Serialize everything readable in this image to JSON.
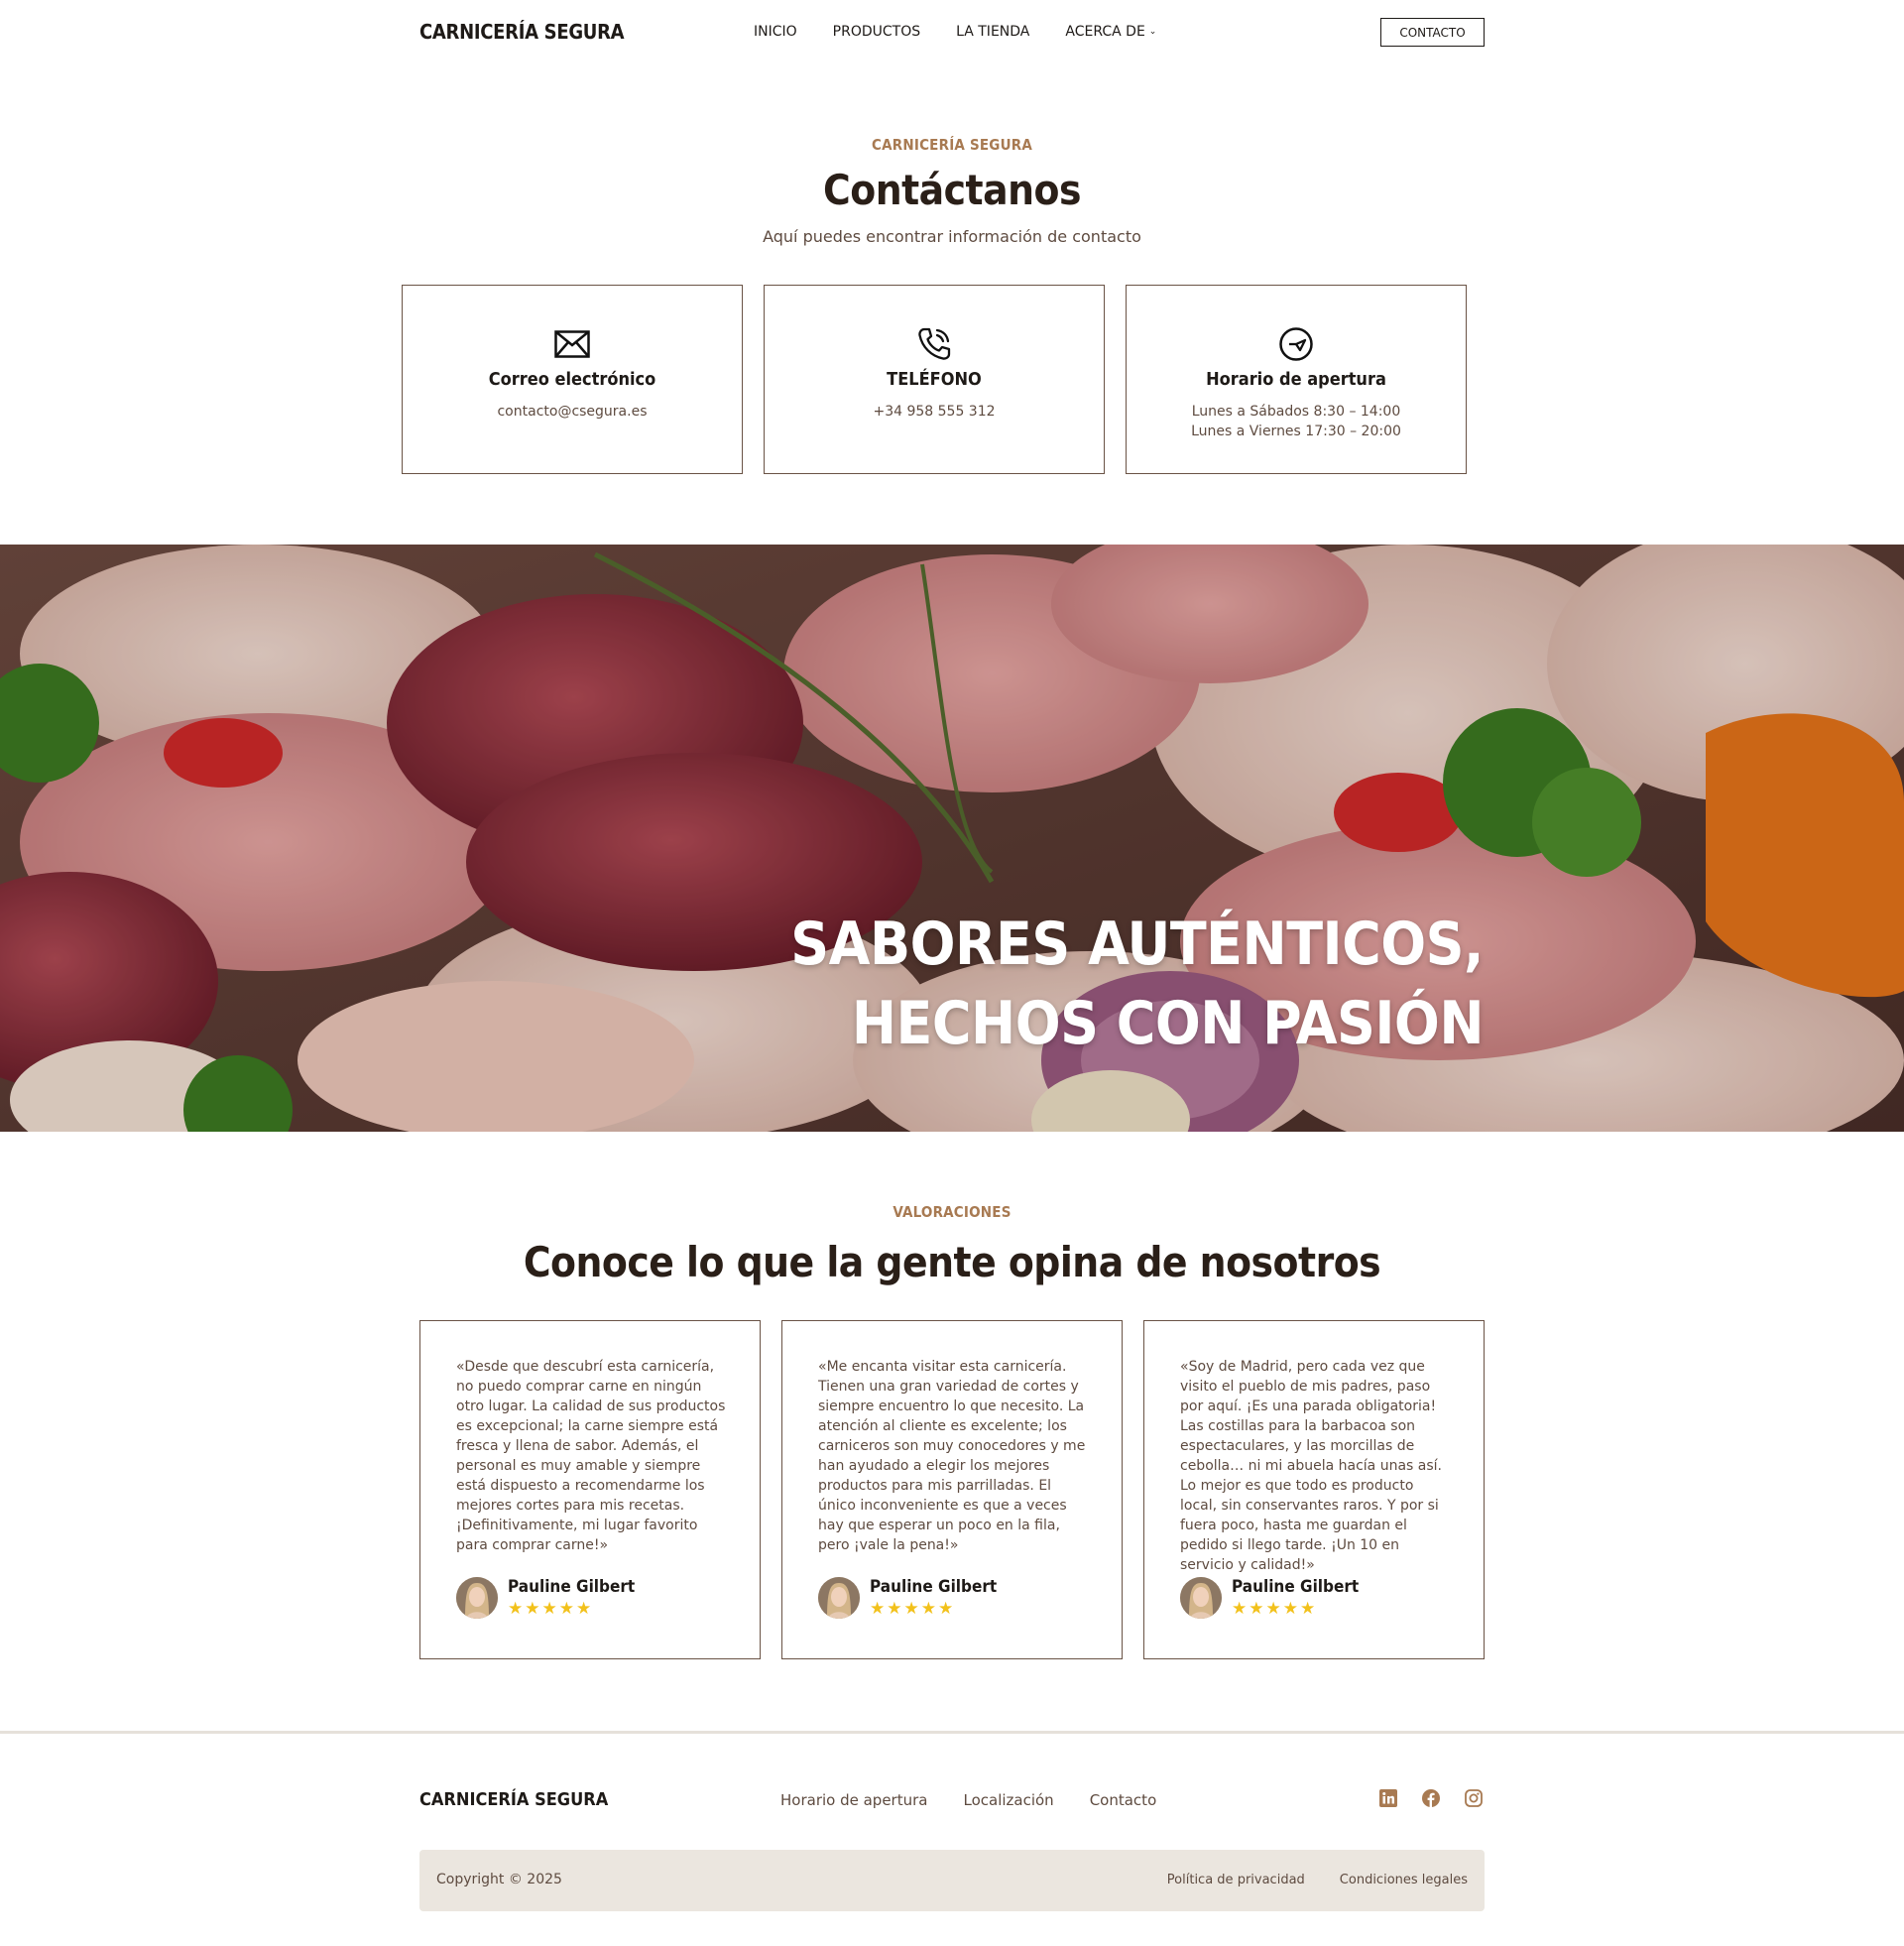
{
  "header": {
    "logo": "CARNICERÍA SEGURA",
    "nav": [
      "INICIO",
      "PRODUCTOS",
      "LA TIENDA",
      "ACERCA DE"
    ],
    "contact_button": "CONTACTO"
  },
  "contact": {
    "eyebrow": "CARNICERÍA SEGURA",
    "title": "Contáctanos",
    "subtitle": "Aquí puedes encontrar información de contacto",
    "cards": [
      {
        "icon": "envelope-icon",
        "title": "Correo electrónico",
        "lines": [
          "contacto@csegura.es"
        ]
      },
      {
        "icon": "phone-icon",
        "title": "TELÉFONO",
        "lines": [
          "+34 958 555 312"
        ]
      },
      {
        "icon": "clock-icon",
        "title": "Horario de apertura",
        "lines": [
          "Lunes a Sábados 8:30 – 14:00",
          "Lunes a Viernes 17:30 – 20:00"
        ]
      }
    ]
  },
  "hero": {
    "line1": "SABORES AUTÉNTICOS,",
    "line2": "HECHOS CON PASIÓN"
  },
  "reviews": {
    "eyebrow": "VALORACIONES",
    "title": "Conoce lo que la gente opina de nosotros",
    "items": [
      {
        "text": "«Desde que descubrí esta carnicería, no puedo comprar carne en ningún otro lugar. La calidad de sus productos es excepcional; la carne siempre está fresca y llena de sabor. Además, el personal es muy amable y siempre está dispuesto a recomendarme los mejores cortes para mis recetas. ¡Definitivamente, mi lugar favorito para comprar carne!»",
        "author": "Pauline Gilbert",
        "rating": 5
      },
      {
        "text": "«Me encanta visitar esta carnicería. Tienen una gran variedad de cortes y siempre encuentro lo que necesito. La atención al cliente es excelente; los carniceros son muy conocedores y me han ayudado a elegir los mejores productos para mis parrilladas. El único inconveniente es que a veces hay que esperar un poco en la fila, pero ¡vale la pena!»",
        "author": "Pauline Gilbert",
        "rating": 5
      },
      {
        "text": "«Soy de Madrid, pero cada vez que visito el pueblo de mis padres, paso por aquí. ¡Es una parada obligatoria! Las costillas para la barbacoa son espectaculares, y las morcillas de cebolla… ni mi abuela hacía unas así. Lo mejor es que todo es producto local, sin conservantes raros. Y por si fuera poco, hasta me guardan el pedido si llego tarde. ¡Un 10 en servicio y calidad!»",
        "author": "Pauline Gilbert",
        "rating": 5
      }
    ]
  },
  "footer": {
    "logo": "CARNICERÍA SEGURA",
    "links": [
      "Horario de apertura",
      "Localización",
      "Contacto"
    ],
    "socials": [
      "linkedin-icon",
      "facebook-icon",
      "instagram-icon"
    ],
    "copyright": "Copyright © 2025",
    "legal": [
      "Política de privacidad",
      "Condiciones legales"
    ]
  },
  "colors": {
    "accent": "#a87a52",
    "heading": "#2a1f18",
    "body": "#5e4b40",
    "star": "#f2c11b",
    "footer_bar": "#ebe6df"
  }
}
